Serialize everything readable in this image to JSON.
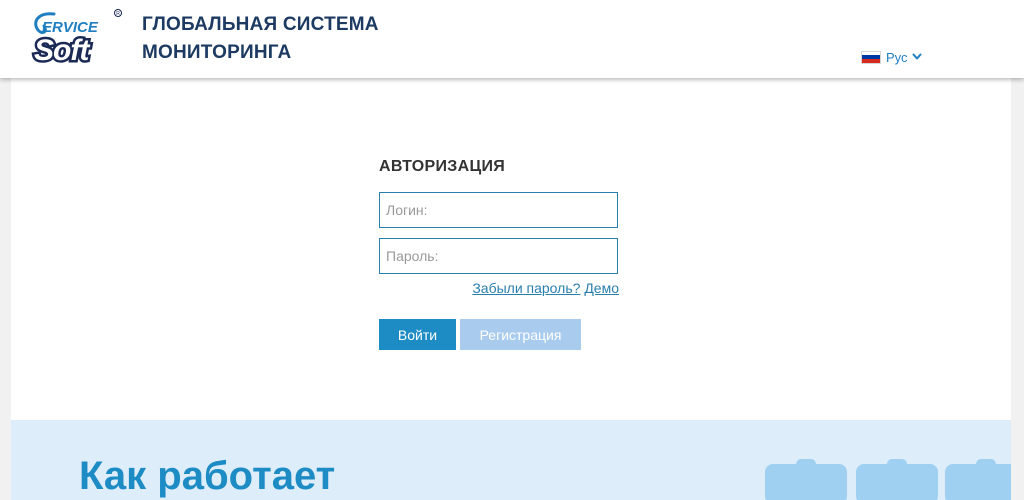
{
  "header": {
    "logo_text_top": "ERVICE",
    "logo_text_bottom": "Soft",
    "title_line1": "ГЛОБАЛЬНАЯ СИСТЕМА",
    "title_line2": "МОНИТОРИНГА",
    "language": {
      "label": "Рус",
      "flag_colors": [
        "#ffffff",
        "#0039a6",
        "#d52b1e"
      ]
    }
  },
  "auth": {
    "title": "АВТОРИЗАЦИЯ",
    "login_placeholder": "Логин:",
    "login_value": "",
    "password_placeholder": "Пароль:",
    "password_value": "",
    "forgot_link": "Забыли пароль?",
    "demo_link": "Демо",
    "login_button": "Войти",
    "register_button": "Регистрация"
  },
  "how_it_works": {
    "title": "Как работает"
  },
  "colors": {
    "brand_dark": "#1d3a62",
    "accent": "#1d8bc4",
    "link": "#2a7fae",
    "disabled_button": "#a9ccee",
    "section_bg": "#deedfa"
  }
}
